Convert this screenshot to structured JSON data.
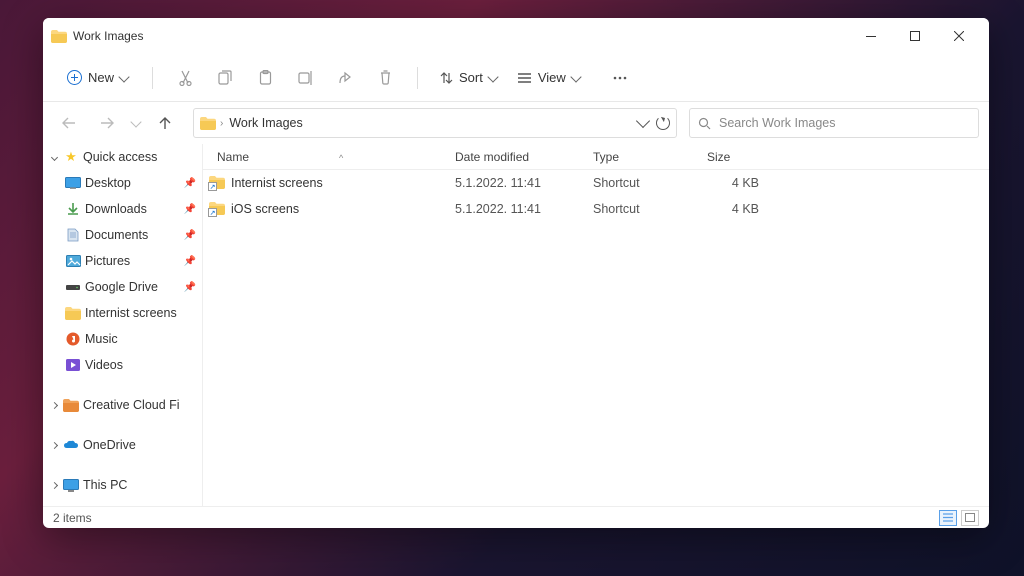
{
  "title": "Work Images",
  "toolbar": {
    "new": "New",
    "sort": "Sort",
    "view": "View"
  },
  "breadcrumb": {
    "segment": "Work Images"
  },
  "search": {
    "placeholder": "Search Work Images"
  },
  "columns": {
    "name": "Name",
    "date": "Date modified",
    "type": "Type",
    "size": "Size"
  },
  "sidebar": {
    "quick": "Quick access",
    "items": [
      {
        "label": "Desktop"
      },
      {
        "label": "Downloads"
      },
      {
        "label": "Documents"
      },
      {
        "label": "Pictures"
      },
      {
        "label": "Google Drive"
      },
      {
        "label": "Internist screens"
      },
      {
        "label": "Music"
      },
      {
        "label": "Videos"
      }
    ],
    "creative": "Creative Cloud Fi",
    "onedrive": "OneDrive",
    "thispc": "This PC"
  },
  "files": [
    {
      "name": "Internist screens",
      "date": "5.1.2022. 11:41",
      "type": "Shortcut",
      "size": "4 KB"
    },
    {
      "name": "iOS screens",
      "date": "5.1.2022. 11:41",
      "type": "Shortcut",
      "size": "4 KB"
    }
  ],
  "status": {
    "count": "2 items"
  }
}
